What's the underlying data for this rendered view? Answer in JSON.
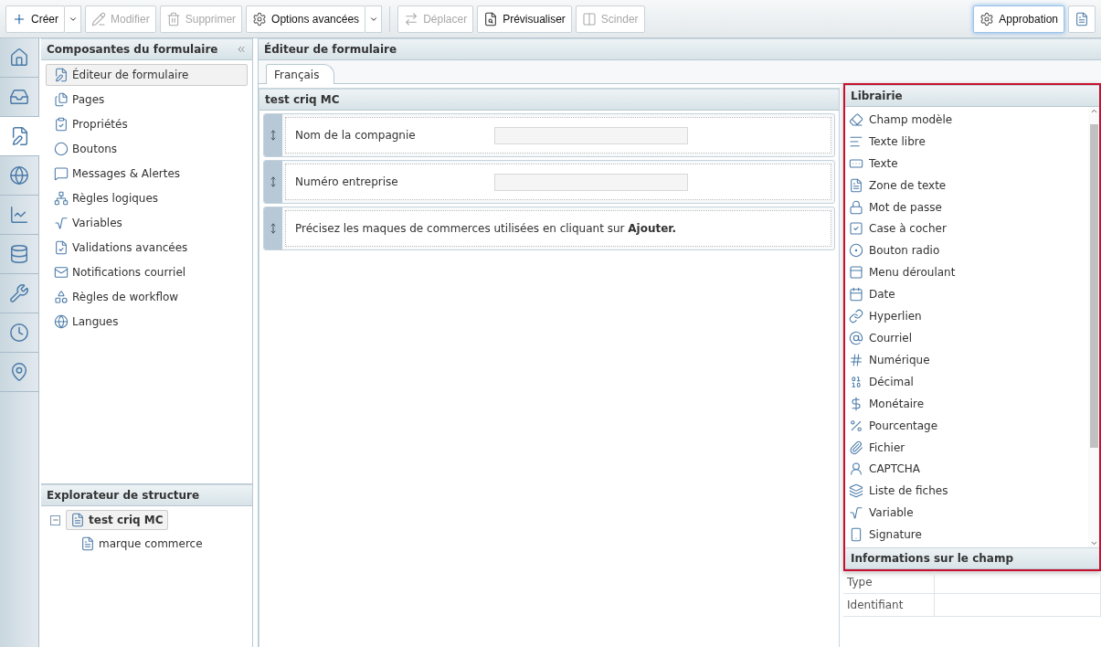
{
  "toolbar": {
    "buttons": [
      {
        "label": "Créer",
        "disabled": false,
        "dropdown": true,
        "selected": false
      },
      {
        "label": "Modifier",
        "disabled": true,
        "dropdown": false,
        "selected": false
      },
      {
        "label": "Supprimer",
        "disabled": true,
        "dropdown": false,
        "selected": false
      },
      {
        "label": "Options avancées",
        "disabled": false,
        "dropdown": true,
        "selected": false
      },
      {
        "label": "Déplacer",
        "disabled": true,
        "dropdown": false,
        "selected": false
      },
      {
        "label": "Prévisualiser",
        "disabled": false,
        "dropdown": false,
        "selected": false
      },
      {
        "label": "Scinder",
        "disabled": true,
        "dropdown": false,
        "selected": false
      }
    ],
    "right_buttons": [
      {
        "label": "Approbation",
        "selected": true
      }
    ]
  },
  "rail": [
    {
      "selected": false
    },
    {
      "selected": false
    },
    {
      "selected": true
    },
    {
      "selected": false
    },
    {
      "selected": false
    },
    {
      "selected": false
    },
    {
      "selected": false
    },
    {
      "selected": false
    },
    {
      "selected": false
    }
  ],
  "components_panel": {
    "title": "Composantes du formulaire",
    "items": [
      {
        "label": "Éditeur de formulaire",
        "selected": true
      },
      {
        "label": "Pages",
        "selected": false
      },
      {
        "label": "Propriétés",
        "selected": false
      },
      {
        "label": "Boutons",
        "selected": false
      },
      {
        "label": "Messages & Alertes",
        "selected": false
      },
      {
        "label": "Règles logiques",
        "selected": false
      },
      {
        "label": "Variables",
        "selected": false
      },
      {
        "label": "Validations avancées",
        "selected": false
      },
      {
        "label": "Notifications courriel",
        "selected": false
      },
      {
        "label": "Règles de workflow",
        "selected": false
      },
      {
        "label": "Langues",
        "selected": false
      }
    ]
  },
  "structure_panel": {
    "title": "Explorateur de structure",
    "tree": [
      {
        "label": "test criq MC",
        "expanded": true,
        "selected": true,
        "children": [
          {
            "label": "marque commerce",
            "selected": false
          }
        ]
      }
    ]
  },
  "editor": {
    "title": "Éditeur de formulaire",
    "tabs": [
      {
        "label": "Français",
        "selected": true
      }
    ],
    "form_title": "test criq MC",
    "rows": [
      {
        "kind": "field",
        "label": "Nom de la compagnie"
      },
      {
        "kind": "field",
        "label": "Numéro entreprise"
      },
      {
        "kind": "text",
        "text": "Précisez les maques de commerces utilisées en cliquant sur **Ajouter.**"
      }
    ]
  },
  "library": {
    "title": "Librairie",
    "items": [
      "Champ modèle",
      "Texte libre",
      "Texte",
      "Zone de texte",
      "Mot de passe",
      "Case à cocher",
      "Bouton radio",
      "Menu déroulant",
      "Date",
      "Hyperlien",
      "Courriel",
      "Numérique",
      "Décimal",
      "Monétaire",
      "Pourcentage",
      "Fichier",
      "CAPTCHA",
      "Liste de fiches",
      "Variable",
      "Signature"
    ]
  },
  "field_info": {
    "title": "Informations sur le champ",
    "rows": [
      {
        "label": "Type"
      },
      {
        "label": "Identifiant"
      }
    ]
  }
}
